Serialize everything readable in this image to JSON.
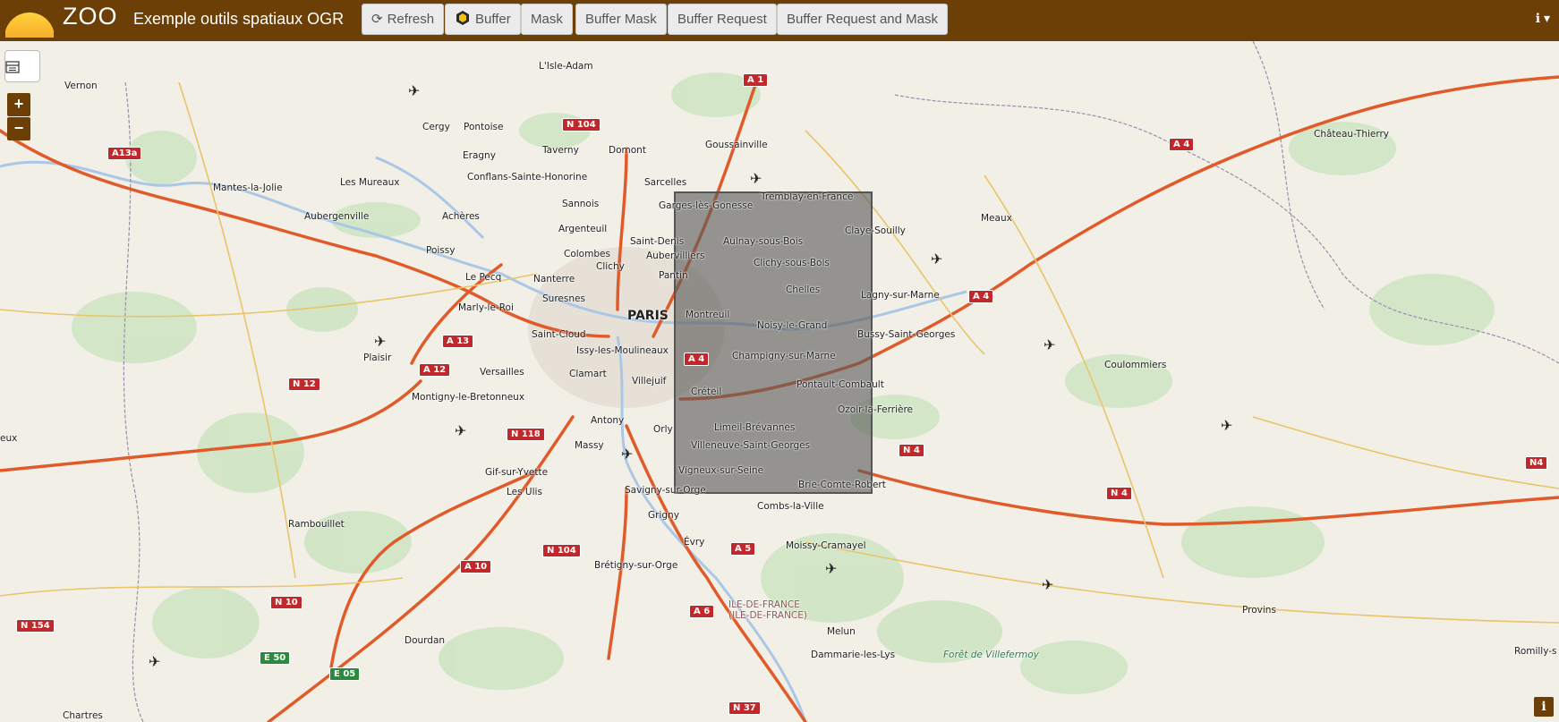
{
  "app": {
    "brand": "ZOO",
    "title": "Exemple outils spatiaux OGR"
  },
  "toolbar": {
    "refresh": "Refresh",
    "buffer": "Buffer",
    "mask": "Mask",
    "buffer_mask": "Buffer Mask",
    "buffer_request": "Buffer Request",
    "buffer_request_mask": "Buffer Request and Mask"
  },
  "map_controls": {
    "zoom_in": "+",
    "zoom_out": "−",
    "info": "i"
  },
  "colors": {
    "navbar": "#6b3f06",
    "selection": "#5a5a5a",
    "road": "#e05a2a"
  },
  "map_labels": {
    "vernon": "Vernon",
    "lisle_adam": "L'Isle-Adam",
    "cergy": "Cergy",
    "pontoise": "Pontoise",
    "eragny": "Eragny",
    "taverny": "Taverny",
    "domont": "Domont",
    "goussainville": "Goussainville",
    "mantes": "Mantes-la-Jolie",
    "les_mureaux": "Les Mureaux",
    "conflans": "Conflans-Sainte-Honorine",
    "sarcelles": "Sarcelles",
    "tremblay": "Tremblay-en-France",
    "aubergenville": "Aubergenville",
    "acheres": "Achères",
    "sannois": "Sannois",
    "garges": "Garges-lès-Gonesse",
    "claye": "Claye-Souilly",
    "meaux": "Meaux",
    "chateau_thierry": "Château-Thierry",
    "argenteuil": "Argenteuil",
    "saint_denis": "Saint-Denis",
    "aulnay": "Aulnay-sous-Bois",
    "poissy": "Poissy",
    "colombes": "Colombes",
    "aubervilliers": "Aubervilliers",
    "clichy_bois": "Clichy-sous-Bois",
    "clichy": "Clichy",
    "le_pecq": "Le Pecq",
    "nanterre": "Nanterre",
    "pantin": "Pantin",
    "chelles": "Chelles",
    "lagny": "Lagny-sur-Marne",
    "suresnes": "Suresnes",
    "marly": "Marly-le-Roi",
    "paris": "PARIS",
    "montreuil": "Montreuil",
    "noisy": "Noisy-le-Grand",
    "bussy": "Bussy-Saint-Georges",
    "saint_cloud": "Saint-Cloud",
    "plaisir": "Plaisir",
    "issy": "Issy-les-Moulineaux",
    "champigny": "Champigny-sur-Marne",
    "coulommiers": "Coulommiers",
    "versailles": "Versailles",
    "clamart": "Clamart",
    "villejuif": "Villejuif",
    "pontault": "Pontault-Combault",
    "montigny": "Montigny-le-Bretonneux",
    "creteil": "Créteil",
    "ozoir": "Ozoir-la-Ferrière",
    "antony": "Antony",
    "orly": "Orly",
    "limeil": "Limeil-Brévannes",
    "massy": "Massy",
    "villeneuve": "Villeneuve-Saint-Georges",
    "gif": "Gif-sur-Yvette",
    "vigneux": "Vigneux-sur-Seine",
    "les_ulis": "Les Ulis",
    "savigny": "Savigny-sur-Orge",
    "brie": "Brie-Comte-Robert",
    "combs": "Combs-la-Ville",
    "grigny": "Grigny",
    "rambouillet": "Rambouillet",
    "evry": "Évry",
    "moissy": "Moissy-Cramayel",
    "bretigny": "Brétigny-sur-Orge",
    "idf1": "ILE-DE-FRANCE",
    "idf2": "(ILE-DE-FRANCE)",
    "provins": "Provins",
    "melun": "Melun",
    "dourdan": "Dourdan",
    "dammarie": "Dammarie-les-Lys",
    "foret": "Forêt de Villefermoy",
    "romilly": "Romilly-s",
    "chartres": "Chartres",
    "eux": "eux"
  },
  "road_shields": {
    "a1": "A 1",
    "a13a": "A13a",
    "n104a": "N 104",
    "a4a": "A 4",
    "a4b": "A 4",
    "a13": "A 13",
    "a12": "A 12",
    "n12": "N 12",
    "a4c": "A 4",
    "n118": "N 118",
    "n4a": "N 4",
    "n4b": "N 4",
    "n4c": "N4",
    "n104b": "N 104",
    "a5": "A 5",
    "a10": "A 10",
    "n10": "N 10",
    "a6": "A 6",
    "n154": "N 154",
    "e50": "E 50",
    "e05": "E 05",
    "n37": "N 37"
  }
}
